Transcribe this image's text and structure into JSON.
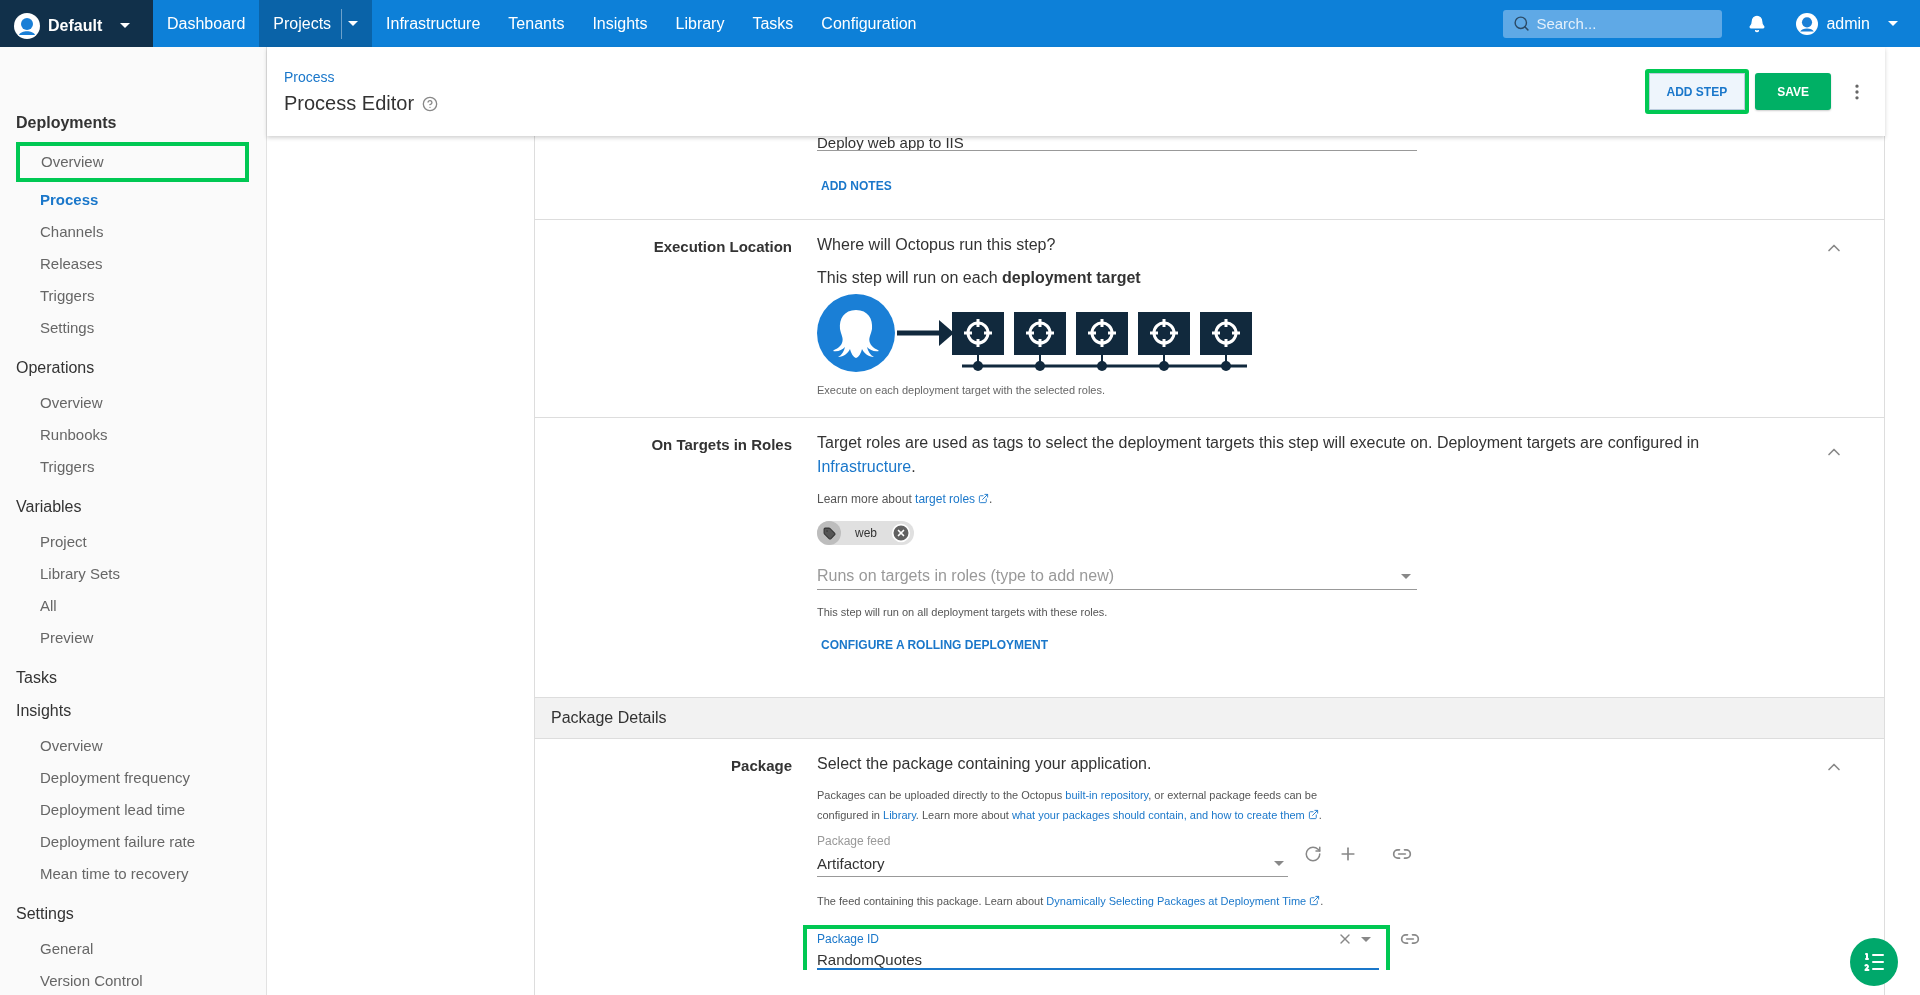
{
  "top_nav": {
    "space": "Default",
    "items": [
      {
        "label": "Dashboard",
        "selected": false,
        "has_menu": false
      },
      {
        "label": "Projects",
        "selected": true,
        "has_menu": true
      },
      {
        "label": "Infrastructure",
        "selected": false,
        "has_menu": false
      },
      {
        "label": "Tenants",
        "selected": false,
        "has_menu": false
      },
      {
        "label": "Insights",
        "selected": false,
        "has_menu": false
      },
      {
        "label": "Library",
        "selected": false,
        "has_menu": false
      },
      {
        "label": "Tasks",
        "selected": false,
        "has_menu": false
      },
      {
        "label": "Configuration",
        "selected": false,
        "has_menu": false
      }
    ],
    "search": {
      "placeholder": "Search..."
    },
    "user": "admin"
  },
  "sidebar": {
    "groups": [
      {
        "title": "Deployments",
        "bold": true,
        "items": [
          {
            "label": "Overview",
            "selected": false,
            "highlighted": true
          },
          {
            "label": "Process",
            "selected": true,
            "highlighted": false
          },
          {
            "label": "Channels",
            "selected": false,
            "highlighted": false
          },
          {
            "label": "Releases",
            "selected": false,
            "highlighted": false
          },
          {
            "label": "Triggers",
            "selected": false,
            "highlighted": false
          },
          {
            "label": "Settings",
            "selected": false,
            "highlighted": false
          }
        ]
      },
      {
        "title": "Operations",
        "bold": false,
        "items": [
          {
            "label": "Overview",
            "selected": false,
            "highlighted": false
          },
          {
            "label": "Runbooks",
            "selected": false,
            "highlighted": false
          },
          {
            "label": "Triggers",
            "selected": false,
            "highlighted": false
          }
        ]
      },
      {
        "title": "Variables",
        "bold": false,
        "items": [
          {
            "label": "Project",
            "selected": false,
            "highlighted": false
          },
          {
            "label": "Library Sets",
            "selected": false,
            "highlighted": false
          },
          {
            "label": "All",
            "selected": false,
            "highlighted": false
          },
          {
            "label": "Preview",
            "selected": false,
            "highlighted": false
          }
        ]
      },
      {
        "title": "Tasks",
        "bold": false
      },
      {
        "title": "Insights",
        "bold": false,
        "items": [
          {
            "label": "Overview",
            "selected": false,
            "highlighted": false
          },
          {
            "label": "Deployment frequency",
            "selected": false,
            "highlighted": false
          },
          {
            "label": "Deployment lead time",
            "selected": false,
            "highlighted": false
          },
          {
            "label": "Deployment failure rate",
            "selected": false,
            "highlighted": false
          },
          {
            "label": "Mean time to recovery",
            "selected": false,
            "highlighted": false
          }
        ]
      },
      {
        "title": "Settings",
        "bold": false,
        "items": [
          {
            "label": "General",
            "selected": false,
            "highlighted": false
          },
          {
            "label": "Version Control",
            "selected": false,
            "highlighted": false
          }
        ]
      }
    ]
  },
  "header": {
    "breadcrumb": "Process",
    "title": "Process Editor",
    "buttons": [
      {
        "label": "ADD STEP",
        "kind": "secondary",
        "highlighted": true
      },
      {
        "label": "SAVE",
        "kind": "primary",
        "highlighted": false
      }
    ]
  },
  "step_name": {
    "value": "Deploy web app to IIS",
    "action": "ADD NOTES"
  },
  "execution_location": {
    "label": "Execution Location",
    "expanded": true,
    "question": "Where will Octopus run this step?",
    "summary": "This step will run on each **deployment target**",
    "caption": "Execute on each deployment target with the selected roles."
  },
  "target_roles": {
    "label": "On Targets in Roles",
    "expanded": true,
    "description": [
      {
        "kind": "text",
        "text": "Target roles are used as tags to select the deployment targets this step will execute on. Deployment targets are configured in "
      },
      {
        "kind": "link",
        "text": "Infrastructure"
      },
      {
        "kind": "text",
        "text": "."
      }
    ],
    "learn_more": [
      {
        "kind": "text",
        "text": "Learn more about "
      },
      {
        "kind": "external",
        "text": "target roles"
      },
      {
        "kind": "text",
        "text": "."
      }
    ],
    "chips": [
      "web"
    ],
    "placeholder": "Runs on targets in roles (type to add new)",
    "help": "This step will run on all deployment targets with these roles.",
    "action": "CONFIGURE A ROLLING DEPLOYMENT"
  },
  "package_details": {
    "title": "Package Details",
    "label": "Package",
    "expanded": true,
    "question": "Select the package containing your application.",
    "help": [
      {
        "kind": "text",
        "text": "Packages can be uploaded directly to the Octopus "
      },
      {
        "kind": "link",
        "text": "built-in repository"
      },
      {
        "kind": "text",
        "text": ", or external package feeds can be configured in "
      },
      {
        "kind": "link",
        "text": "Library"
      },
      {
        "kind": "text",
        "text": ". Learn more about "
      },
      {
        "kind": "external",
        "text": "what your packages should contain, and how to create them"
      },
      {
        "kind": "text",
        "text": "."
      }
    ],
    "feed": {
      "label": "Package feed",
      "value": "Artifactory"
    },
    "feed_help": [
      {
        "kind": "text",
        "text": "The feed containing this package. Learn about "
      },
      {
        "kind": "external",
        "text": "Dynamically Selecting Packages at Deployment Time"
      },
      {
        "kind": "text",
        "text": "."
      }
    ],
    "package_id": {
      "label": "Package ID",
      "value": "RandomQuotes",
      "highlighted": true
    }
  }
}
